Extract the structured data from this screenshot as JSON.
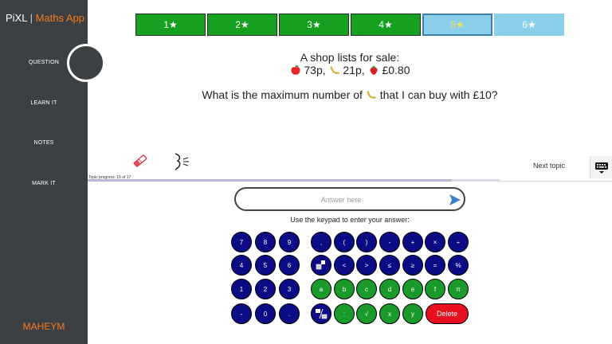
{
  "sidebar": {
    "brand_name": "PiXL",
    "brand_sep": " | ",
    "brand_app": "Maths App",
    "items": [
      {
        "label": "QUESTION"
      },
      {
        "label": "LEARN IT"
      },
      {
        "label": "NOTES"
      },
      {
        "label": "MARK IT"
      }
    ],
    "user": "MAHEYM"
  },
  "levels": [
    {
      "label": "1★",
      "state": "done"
    },
    {
      "label": "2★",
      "state": "done"
    },
    {
      "label": "3★",
      "state": "done"
    },
    {
      "label": "4★",
      "state": "done"
    },
    {
      "label": "5★",
      "state": "selected"
    },
    {
      "label": "6★",
      "state": "locked"
    }
  ],
  "question": {
    "line1": "A shop lists for sale:",
    "item1_price": "73p,",
    "item2_price": "21p,",
    "item3_price": "£0.80",
    "ask_before": "What is the maximum number of",
    "ask_after": "that I can buy with £10?"
  },
  "toolbar": {
    "next_topic": "Next topic"
  },
  "progress": {
    "text": "Topic progress: 15 of 17",
    "current": 15,
    "total": 17
  },
  "answer": {
    "placeholder": "Answer here",
    "hint": "Use the keypad to enter your answer:"
  },
  "keypad": {
    "numeric": [
      [
        "7",
        "8",
        "9"
      ],
      [
        "4",
        "5",
        "6"
      ],
      [
        "1",
        "2",
        "3"
      ],
      [
        "-",
        "0",
        "."
      ]
    ],
    "symbols_row1": [
      ",",
      "(",
      ")",
      "-",
      "+",
      "×",
      "÷"
    ],
    "symbols_row2": [
      "<",
      ">",
      "≤",
      "≥",
      "=",
      "%"
    ],
    "letters_row": [
      "a",
      "b",
      "c",
      "d",
      "e",
      "f",
      "π"
    ],
    "last_row": [
      ":",
      "√",
      "x",
      "y"
    ],
    "delete_label": "Delete"
  },
  "colors": {
    "sidebar": "#3d4042",
    "accent": "#f47a20",
    "level_done": "#15a01f",
    "level_locked": "#8bd0ea",
    "key_blue": "#0b0b86",
    "key_green": "#1a9a2a",
    "key_delete": "#e8101e"
  }
}
